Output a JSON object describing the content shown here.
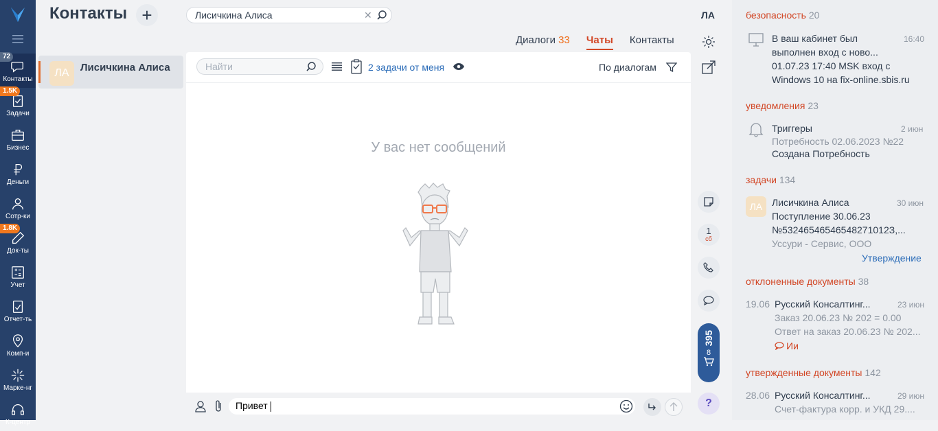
{
  "nav": {
    "items": [
      {
        "label": "Контакты",
        "badge": "72"
      },
      {
        "label": "Задачи",
        "badge": "1.5K"
      },
      {
        "label": "Бизнес"
      },
      {
        "label": "Деньги"
      },
      {
        "label": "Сотр-ки"
      },
      {
        "label": "Док-ты",
        "badge": "1.8K"
      },
      {
        "label": "Учет"
      },
      {
        "label": "Отчет-ть"
      },
      {
        "label": "Комп-и"
      },
      {
        "label": "Марке-нг"
      },
      {
        "label": "К-центр"
      }
    ]
  },
  "header": {
    "title": "Контакты",
    "search_value": "Лисичкина Алиса",
    "user_initials": "ЛА"
  },
  "tabs": [
    {
      "label": "Диалоги",
      "count": "33"
    },
    {
      "label": "Чаты",
      "count": ""
    },
    {
      "label": "Контакты",
      "count": ""
    }
  ],
  "contact": {
    "name": "Лисичкина Алиса",
    "initials": "ЛА"
  },
  "chat": {
    "find_placeholder": "Найти",
    "tasks_label": "2 задачи от меня",
    "filter_label": "По диалогам",
    "empty_text": "У вас нет сообщений"
  },
  "composer": {
    "value": "Привет"
  },
  "side_buttons": {
    "counter_value": "1",
    "counter_unit": "сб",
    "cart_count": "395",
    "cart_sub": "8",
    "help": "?"
  },
  "right_panel": {
    "security": {
      "title": "безопасность",
      "count": "20",
      "line1": "В ваш кабинет был",
      "line2": "выполнен вход с ново...",
      "line3": "01.07.23 17:40 MSK вход с",
      "line4": "Windows 10 на fix-online.sbis.ru",
      "time": "16:40"
    },
    "notifications": {
      "title": "уведомления",
      "count": "23",
      "name": "Триггеры",
      "sub": "Потребность 02.06.2023 №22",
      "text": "Создана Потребность",
      "time": "2 июн"
    },
    "tasks": {
      "title": "задачи",
      "count": "134",
      "initials": "ЛА",
      "name": "Лисичкина Алиса",
      "line1": "Поступление 30.06.23",
      "line2": "№53246546546548271012З,...",
      "line3": "Уссури - Сервис, ООО",
      "action": "Утверждение",
      "time": "30 июн"
    },
    "rejected": {
      "title": "отклоненные документы",
      "count": "38",
      "date": "19.06",
      "name": "Русский Консалтинг...",
      "line1": "Заказ 20.06.23 № 202 = 0.00",
      "line2": "Ответ на заказ 20.06.23 № 202...",
      "comment": "Ии",
      "time": "23 июн"
    },
    "approved": {
      "title": "утвержденные документы",
      "count": "142",
      "date": "28.06",
      "name": "Русский Консалтинг...",
      "line1": "Счет-фактура корр. и УКД 29....",
      "time": "29 июн"
    }
  },
  "colors": {
    "nav_bg": "#27416a",
    "accent": "#d24726",
    "badge_orange": "#f0781e",
    "cart_bg": "#2e5b9a"
  }
}
